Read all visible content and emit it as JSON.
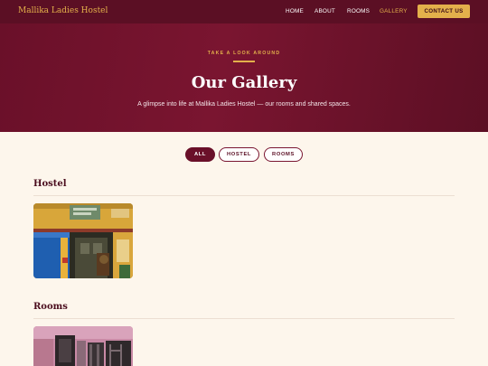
{
  "nav": {
    "brand": "Mallika Ladies Hostel",
    "links": [
      "HOME",
      "ABOUT",
      "ROOMS",
      "GALLERY"
    ],
    "cta": "CONTACT US"
  },
  "hero": {
    "eyebrow": "TAKE A LOOK AROUND",
    "title": "Our Gallery",
    "subtitle": "A glimpse into life at Mallika Ladies Hostel — our rooms and shared spaces."
  },
  "filters": [
    "ALL",
    "HOSTEL",
    "ROOMS"
  ],
  "sections": {
    "hostel": {
      "title": "Hostel"
    },
    "rooms": {
      "title": "Rooms"
    }
  },
  "colors": {
    "maroon": "#5b0f24",
    "gold": "#e3b04b",
    "cream": "#fdf6ec"
  }
}
